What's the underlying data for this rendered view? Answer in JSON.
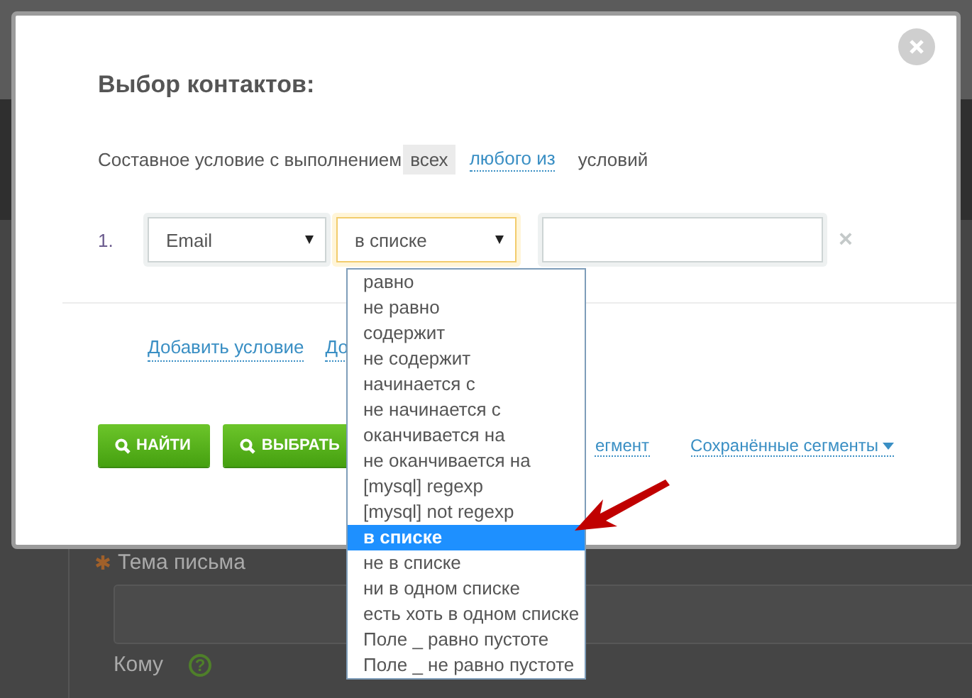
{
  "background": {
    "subject_label": "Тема письма",
    "subject_required": true,
    "to_label": "Кому",
    "help_icon": "?"
  },
  "dialog": {
    "title": "Выбор контактов:",
    "match_mode": {
      "prefix": "Составное условие с выполнением",
      "options": [
        {
          "label": "всех",
          "selected": true
        },
        {
          "label": "любого из",
          "selected": false
        }
      ],
      "suffix": "условий"
    },
    "conditions": [
      {
        "number": "1.",
        "field": "Email",
        "operator": "в списке",
        "remove": "×"
      }
    ],
    "links": [
      "Добавить условие",
      "До"
    ],
    "buttons": [
      {
        "label": "НАЙТИ"
      },
      {
        "label": "ВЫБРАТЬ"
      }
    ],
    "segment_links": [
      {
        "label": "егмент",
        "kind": "link"
      },
      {
        "label": "Сохранённые сегменты",
        "kind": "menu"
      }
    ],
    "dropdown": {
      "options": [
        {
          "label": "равно",
          "selected": false
        },
        {
          "label": "не равно",
          "selected": false
        },
        {
          "label": "содержит",
          "selected": false
        },
        {
          "label": "не содержит",
          "selected": false
        },
        {
          "label": "начинается с",
          "selected": false
        },
        {
          "label": "не начинается с",
          "selected": false
        },
        {
          "label": "оканчивается на",
          "selected": false
        },
        {
          "label": "не оканчивается на",
          "selected": false
        },
        {
          "label": "[mysql] regexp",
          "selected": false
        },
        {
          "label": "[mysql] not regexp",
          "selected": false
        },
        {
          "label": "в списке",
          "selected": true
        },
        {
          "label": "не в списке",
          "selected": false
        },
        {
          "label": "ни в одном списке",
          "selected": false
        },
        {
          "label": "есть хоть в одном списке",
          "selected": false
        },
        {
          "label": "Поле _ равно пустоте",
          "selected": false
        },
        {
          "label": "Поле _ не равно пустоте",
          "selected": false
        }
      ]
    }
  }
}
